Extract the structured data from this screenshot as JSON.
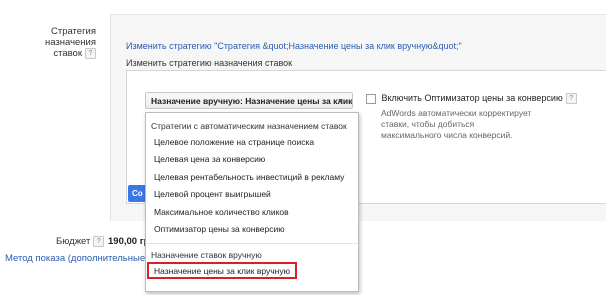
{
  "sidebar": {
    "strategy_label_line1": "Стратегия назначения",
    "strategy_label_line2": "ставок",
    "budget_label": "Бюджет",
    "budget_value": "190,00 гр",
    "delivery_link": "Метод показа (дополнительные н"
  },
  "panel": {
    "change_strategy_link": "Изменить стратегию \"Стратегия &quot;Назначение цены за клик вручную&quot;\"",
    "change_strategy_heading": "Изменить стратегию назначения ставок",
    "save_button_label": "Со",
    "select_value": "Назначение вручную: Назначение цены за клик ...",
    "optimizer_checkbox_label": "Включить Оптимизатор цены за конверсию",
    "optimizer_description_line1": "AdWords автоматически корректирует",
    "optimizer_description_line2": "ставки, чтобы добиться",
    "optimizer_description_line3": "максимального числа конверсий."
  },
  "dropdown": {
    "auto_group_heading": "Стратегии с автоматическим назначением ставок",
    "auto_items": [
      "Целевое положение на странице поиска",
      "Целевая цена за конверсию",
      "Целевая рентабельность инвестиций в рекламу",
      "Целевой процент выигрышей",
      "Максимальное количество кликов",
      "Оптимизатор цены за конверсию"
    ],
    "manual_group_heading": "Назначение ставок вручную",
    "manual_items": [
      "Назначение цены за клик вручную"
    ]
  },
  "icons": {
    "help": "question-mark-icon",
    "select_arrow": "triangle-down-icon"
  },
  "colors": {
    "link": "#2a5db0",
    "highlight": "#d6202a",
    "button": "#3b78e7"
  }
}
